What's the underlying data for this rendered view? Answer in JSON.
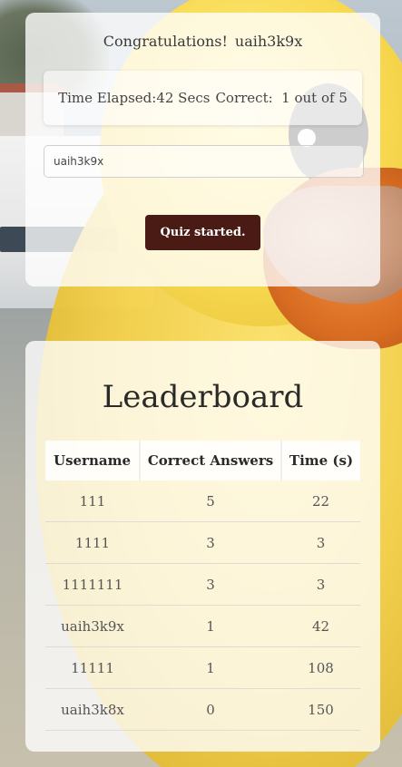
{
  "quiz": {
    "congrats_label": "Congratulations!",
    "username": "uaih3k9x",
    "time_elapsed_text": "Time Elapsed:42 Secs",
    "correct_text": "Correct:  1 out of 5",
    "username_input_value": "uaih3k9x",
    "status_button_label": "Quiz started."
  },
  "leaderboard": {
    "title": "Leaderboard",
    "columns": [
      "Username",
      "Correct Answers",
      "Time (s)"
    ],
    "rows": [
      {
        "username": "111",
        "correct": "5",
        "time": "22"
      },
      {
        "username": "1111",
        "correct": "3",
        "time": "3"
      },
      {
        "username": "1111111",
        "correct": "3",
        "time": "3"
      },
      {
        "username": "uaih3k9x",
        "correct": "1",
        "time": "42"
      },
      {
        "username": "11111",
        "correct": "1",
        "time": "108"
      },
      {
        "username": "uaih3k8x",
        "correct": "0",
        "time": "150"
      }
    ]
  },
  "colors": {
    "button_bg": "#4a1a14",
    "panel_bg": "rgba(255,255,255,0.78)"
  }
}
